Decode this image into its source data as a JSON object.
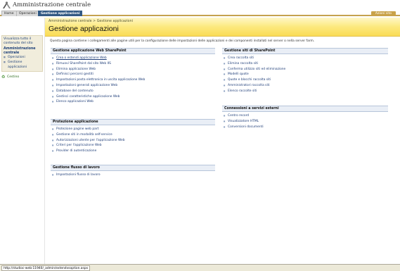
{
  "app": {
    "title": "Amministrazione centrale"
  },
  "tabs": [
    {
      "label": "Home"
    },
    {
      "label": "Operazioni"
    },
    {
      "label": "Gestione applicazioni"
    }
  ],
  "account": {
    "label": "Azioni sito"
  },
  "leftnav": {
    "view_all": "Visualizza tutto il contenuto del sito",
    "heading": "Amministrazione centrale",
    "items": [
      {
        "label": "Operazioni"
      },
      {
        "label": "Gestione applicazioni"
      }
    ],
    "recycle": "Cestino"
  },
  "header": {
    "breadcrumb": "Amministrazione centrale > Gestione applicazioni",
    "page_title": "Gestione applicazioni"
  },
  "intro": "Questa pagina contiene i collegamenti alle pagine utili per la configurazione delle impostazioni delle applicazioni e dei componenti installati nel server o nella server farm.",
  "sections": {
    "web_app": {
      "title": "Gestione applicazione Web SharePoint",
      "links": [
        "Crea o estendi applicazione Web",
        "Rimuovi SharePoint dal sito Web IIS",
        "Elimina applicazione Web",
        "Definisci percorsi gestiti",
        "Impostazioni posta elettronica in uscita applicazione Web",
        "Impostazioni generali applicazione Web",
        "Database del contenuto",
        "Gestisci caratteristiche applicazione Web",
        "Elenco applicazioni Web"
      ]
    },
    "security": {
      "title": "Protezione applicazione",
      "links": [
        "Protezione pagine web part",
        "Gestione siti in modalità self-service",
        "Autorizzazioni utente per l'applicazione Web",
        "Criteri per l'applicazione Web",
        "Provider di autenticazione"
      ]
    },
    "workflow": {
      "title": "Gestione flusso di lavoro",
      "links": [
        "Impostazioni flusso di lavoro"
      ]
    },
    "site_mgmt": {
      "title": "Gestione siti di SharePoint",
      "links": [
        "Crea raccolta siti",
        "Elimina raccolta siti",
        "Conferma utilizzo siti ed eliminazione",
        "Modelli quote",
        "Quote e blocchi raccolta siti",
        "Amministratori raccolta siti",
        "Elenco raccolte siti"
      ]
    },
    "external": {
      "title": "Connessioni a servizi esterni",
      "links": [
        "Centro record",
        "Visualizzatore HTML",
        "Conversioni documenti"
      ]
    }
  },
  "status": {
    "text": "http://studioc-web:11940/_admin/extendvsoption.aspx"
  },
  "colors": {
    "tab_active": "#335a84",
    "header_gold": "#fadc55",
    "accent_button": "#c9a24a",
    "link": "#1e3d78"
  }
}
